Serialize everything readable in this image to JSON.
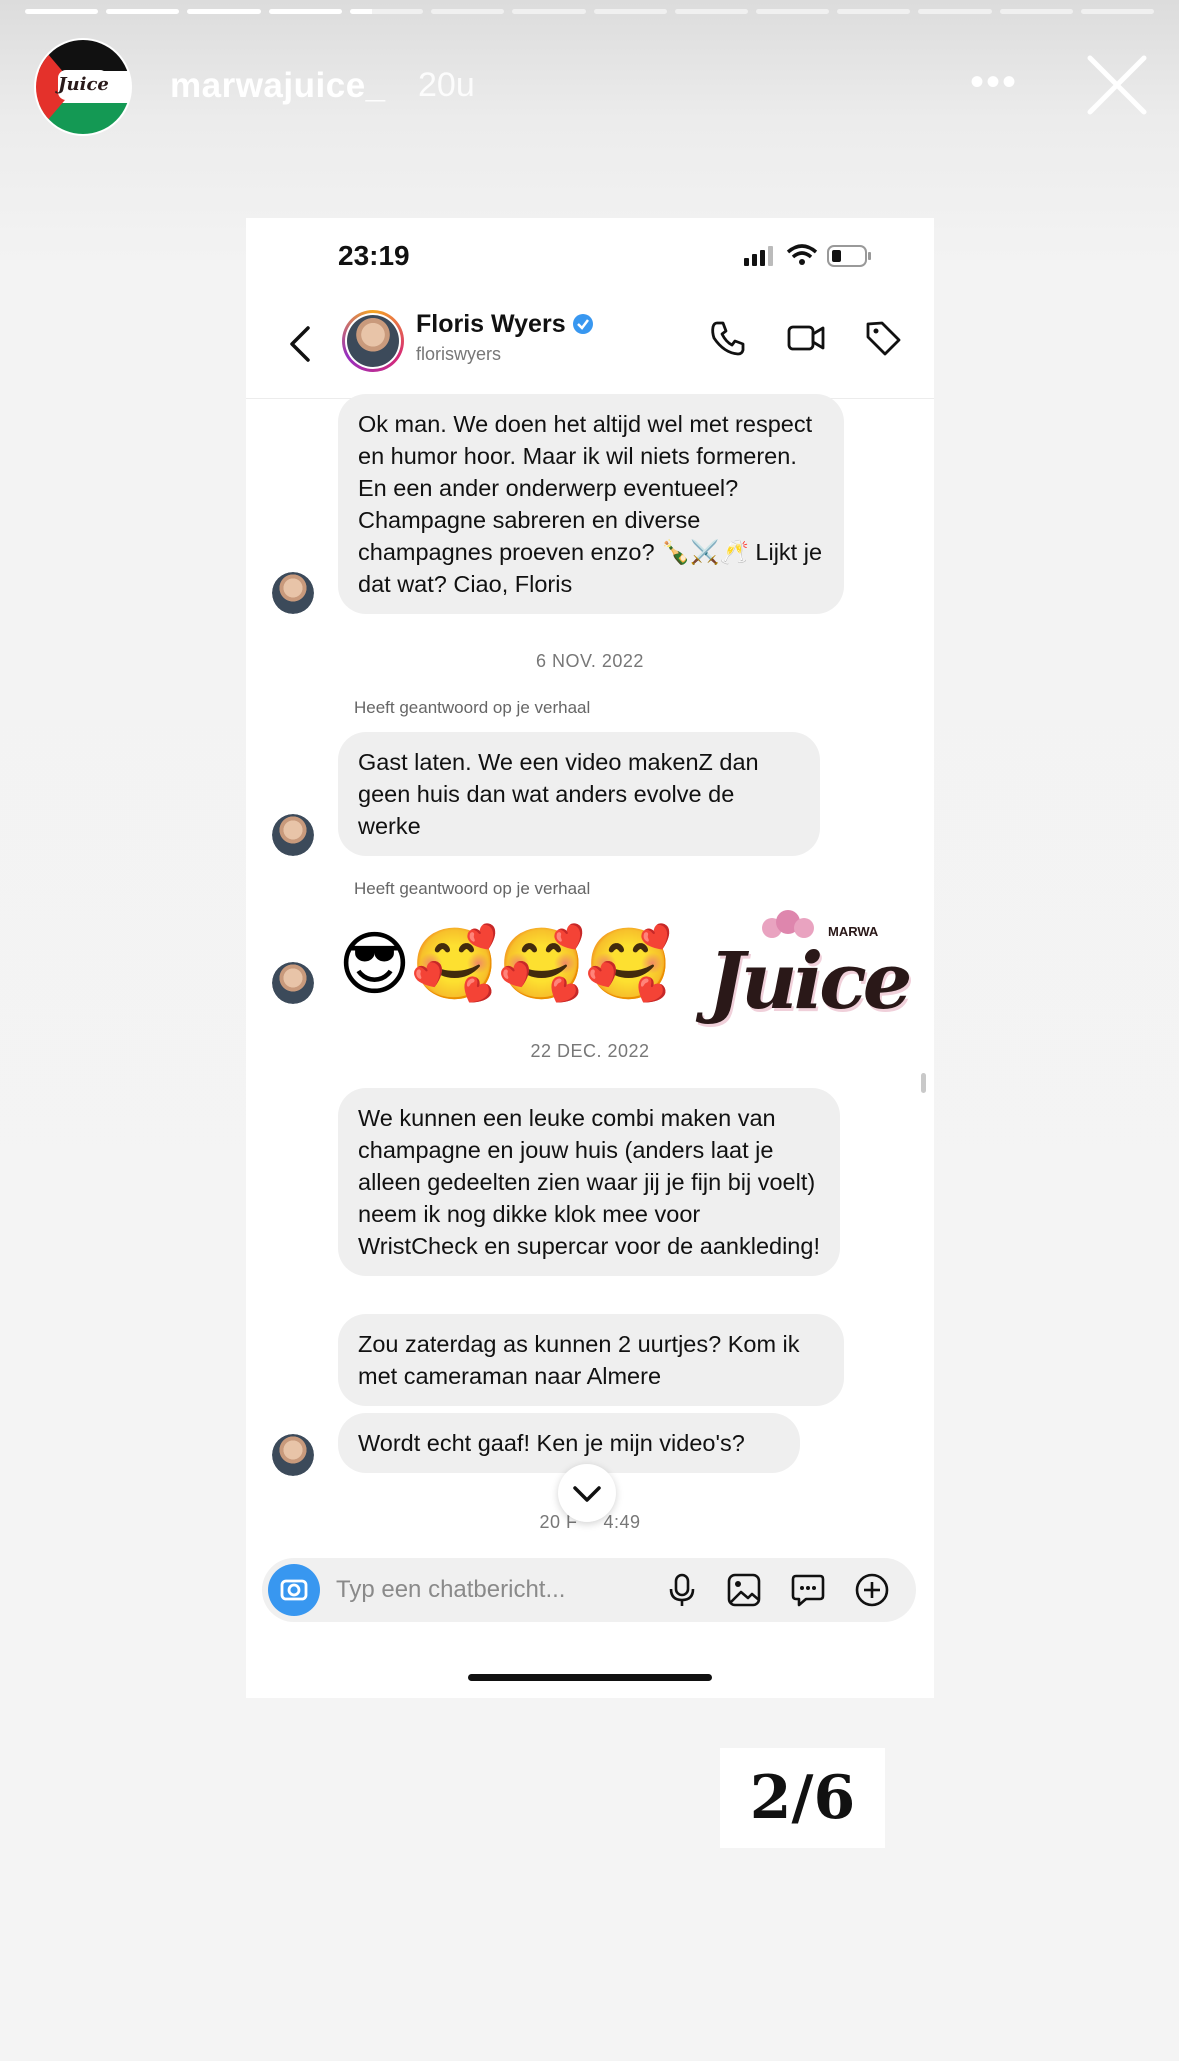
{
  "story": {
    "username": "marwajuice_",
    "age": "20u",
    "progress_total": 14,
    "progress_done": 4,
    "progress_current_fraction": 0.3,
    "more_icon": "more-dots-icon",
    "close_icon": "close-icon"
  },
  "phone": {
    "status_time": "23:19",
    "contact": {
      "name": "Floris Wyers",
      "handle": "floriswyers",
      "verified": true
    },
    "input_placeholder": "Typ een chatbericht...",
    "colors": {
      "accent": "#3897f0",
      "bubble": "#efefef"
    }
  },
  "messages": {
    "m1": "Ok man. We doen het altijd wel met respect en humor hoor. Maar ik wil niets formeren. En een ander onderwerp eventueel? Champagne sabreren en diverse champagnes proeven enzo? 🍾⚔️🥂 Lijkt je dat wat? Ciao, Floris",
    "date1": "6 NOV. 2022",
    "reply_note1": "Heeft geantwoord op je verhaal",
    "m2": "Gast laten. We een video makenZ dan geen huis dan wat anders evolve de werke",
    "reply_note2": "Heeft geantwoord op je verhaal",
    "emojis": "😎🥰🥰🥰",
    "sticker_text": "Juice",
    "sticker_small": "MARWA",
    "date2": "22 DEC. 2022",
    "m3": "We kunnen een leuke combi maken van champagne en jouw huis (anders laat je alleen gedeelten zien waar jij je fijn bij voelt) neem ik nog dikke klok mee voor WristCheck en supercar voor de aankleding!",
    "m4": "Zou zaterdag as kunnen 2 uurtjes? Kom ik met cameraman naar Almere",
    "m5": "Wordt echt gaaf! Ken je mijn video's?",
    "date3": "20 F",
    "date3_tail": "4:49"
  },
  "counter": "2/6"
}
